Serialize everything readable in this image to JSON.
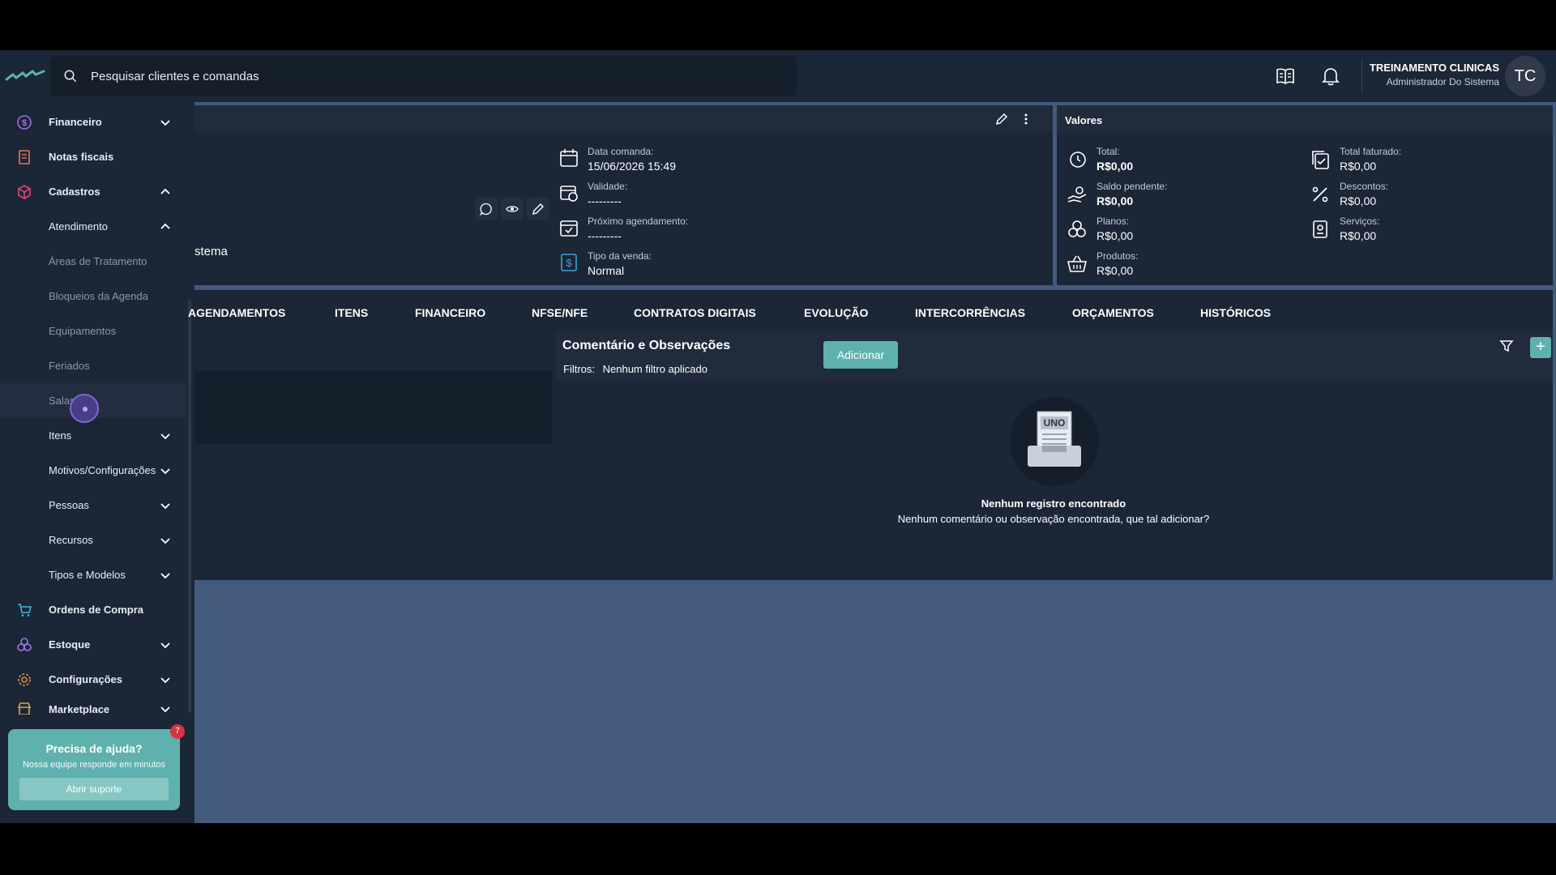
{
  "search": {
    "placeholder": "Pesquisar clientes e comandas"
  },
  "user": {
    "name": "TREINAMENTO CLINICAS",
    "role": "Administrador Do Sistema",
    "initials": "TC"
  },
  "sidebar": {
    "financeiro": "Financeiro",
    "notas_fiscais": "Notas fiscais",
    "cadastros": "Cadastros",
    "atendimento": "Atendimento",
    "areas_tratamento": "Áreas de Tratamento",
    "bloqueios_agenda": "Bloqueios da Agenda",
    "equipamentos": "Equipamentos",
    "feriados": "Feriados",
    "salas": "Salas",
    "itens": "Itens",
    "motivos_configuracoes": "Motivos/Configurações",
    "pessoas": "Pessoas",
    "recursos": "Recursos",
    "tipos_modelos": "Tipos e Modelos",
    "ordens_compra": "Ordens de Compra",
    "estoque": "Estoque",
    "configuracoes": "Configurações",
    "marketplace": "Marketplace"
  },
  "help": {
    "title": "Precisa de ajuda?",
    "subtitle": "Nossa equipe responde em minutos",
    "button": "Abrir suporte",
    "badge": "7"
  },
  "comanda": {
    "partial_text": "stema",
    "data_label": "Data comanda:",
    "data_value": "15/06/2026 15:49",
    "validade_label": "Validade:",
    "validade_value": "---------",
    "proximo_label": "Próximo agendamento:",
    "proximo_value": "---------",
    "tipo_label": "Tipo da venda:",
    "tipo_value": "Normal"
  },
  "valores": {
    "title": "Valores",
    "total_label": "Total:",
    "total_value": "R$0,00",
    "saldo_label": "Saldo pendente:",
    "saldo_value": "R$0,00",
    "planos_label": "Planos:",
    "planos_value": "R$0,00",
    "produtos_label": "Produtos:",
    "produtos_value": "R$0,00",
    "faturado_label": "Total faturado:",
    "faturado_value": "R$0,00",
    "descontos_label": "Descontos:",
    "descontos_value": "R$0,00",
    "servicos_label": "Serviços:",
    "servicos_value": "R$0,00"
  },
  "tabs": [
    "AGENDAMENTOS",
    "ITENS",
    "FINANCEIRO",
    "NFSE/NFE",
    "CONTRATOS DIGITAIS",
    "EVOLUÇÃO",
    "INTERCORRÊNCIAS",
    "ORÇAMENTOS",
    "HISTÓRICOS"
  ],
  "comentarios": {
    "title": "Comentário e Observações",
    "filters_label": "Filtros:",
    "filters_value": "Nenhum filtro aplicado",
    "empty_logo": "UNO",
    "empty_title": "Nenhum registro encontrado",
    "empty_subtitle": "Nenhum comentário ou observação encontrada, que tal adicionar?",
    "add_button": "Adicionar"
  },
  "colors": {
    "accent": "#5fb1ae",
    "panel": "#1b2636",
    "background": "#425b7c"
  }
}
